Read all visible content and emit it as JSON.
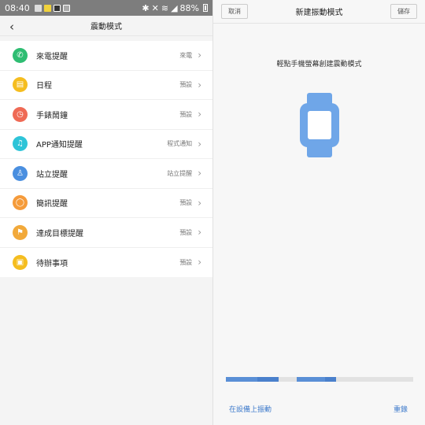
{
  "status_bar": {
    "time": "08:40",
    "battery": "88%"
  },
  "left": {
    "title": "震動模式",
    "items": [
      {
        "label": "來電提醒",
        "value": "來電",
        "icon": "phone-icon",
        "color": "#2ebd72"
      },
      {
        "label": "日程",
        "value": "預設",
        "icon": "calendar-icon",
        "color": "#f5bd1f"
      },
      {
        "label": "手錶鬧鐘",
        "value": "預設",
        "icon": "alarm-clock-icon",
        "color": "#ef6a55"
      },
      {
        "label": "APP通知提醒",
        "value": "程式通知",
        "icon": "bell-icon",
        "color": "#2ec4d8"
      },
      {
        "label": "站立提醒",
        "value": "站立提醒",
        "icon": "person-standing-icon",
        "color": "#4a8fe0"
      },
      {
        "label": "簡訊提醒",
        "value": "預設",
        "icon": "message-icon",
        "color": "#f59b3a"
      },
      {
        "label": "達成目標提醒",
        "value": "預設",
        "icon": "goal-flag-icon",
        "color": "#f2a93a"
      },
      {
        "label": "待辦事項",
        "value": "預設",
        "icon": "todo-icon",
        "color": "#f5bd1f"
      }
    ]
  },
  "right": {
    "cancel_label": "取消",
    "title": "新建振動模式",
    "save_label": "儲存",
    "hint": "輕點手機螢幕創建震動模式",
    "pattern_segments": [
      {
        "start": 0.0,
        "end": 0.17
      },
      {
        "start": 0.17,
        "end": 0.28
      },
      {
        "start": 0.38,
        "end": 0.53
      },
      {
        "start": 0.53,
        "end": 0.59
      }
    ],
    "vibrate_on_device_label": "在設備上振動",
    "reset_label": "重錄"
  }
}
